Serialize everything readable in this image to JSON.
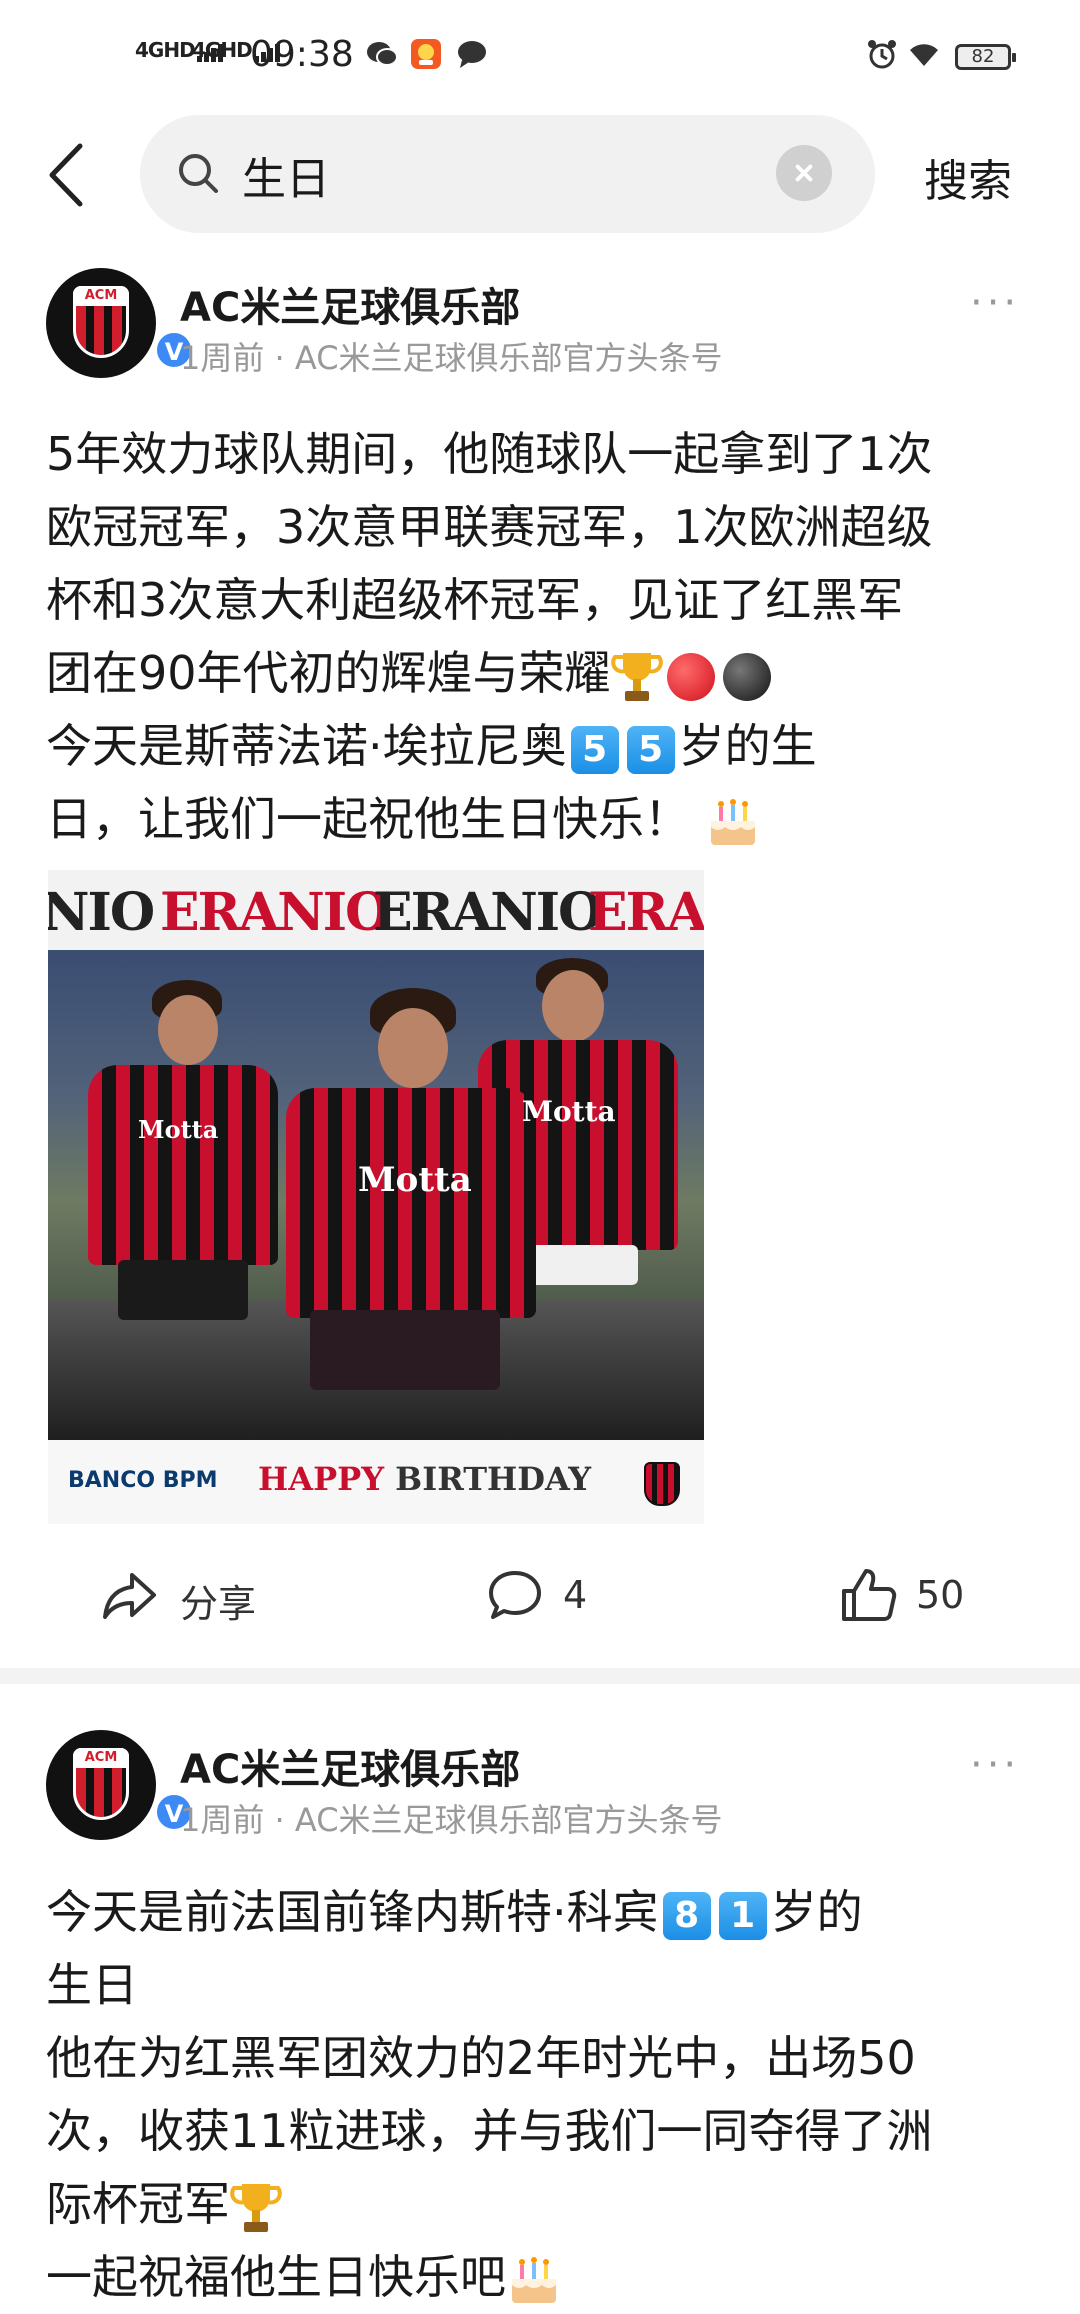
{
  "status_bar": {
    "signal1": "4GHD",
    "signal2": "4GHD",
    "time": "09:38",
    "battery": "82"
  },
  "search": {
    "query": "生日",
    "submit_label": "搜索"
  },
  "posts": [
    {
      "author": "AC米兰足球俱乐部",
      "meta": "1周前 · AC米兰足球俱乐部官方头条号",
      "text_lines": [
        "5年效力球队期间，他随球队一起拿到了1次",
        "欧冠冠军，3次意甲联赛冠军，1次欧洲超级",
        "杯和3次意大利超级杯冠军，见证了红黑军",
        "团在90年代初的辉煌与荣耀",
        "今天是斯蒂法诺·埃拉尼奥",
        "岁的生",
        "日，让我们一起祝他生日快乐！"
      ],
      "age_digits": [
        "5",
        "5"
      ],
      "image": {
        "banner_text": "NIO ERANIO ERANIO ERA",
        "banner_words": [
          "NIO",
          "ERANIO",
          "ERANIO",
          "ERA"
        ],
        "sponsor": "BANCO BPM",
        "caption_1": "HAPPY",
        "caption_2": "BIRTHDAY",
        "shirt_text": "Motta"
      },
      "actions": {
        "share_label": "分享",
        "comments": "4",
        "likes": "50"
      }
    },
    {
      "author": "AC米兰足球俱乐部",
      "meta": "1周前 · AC米兰足球俱乐部官方头条号",
      "text_lines": [
        "今天是前法国前锋内斯特·科宾",
        "岁的",
        "生日",
        "他在为红黑军团效力的2年时光中，出场50",
        "次，收获11粒进球，并与我们一同夺得了洲",
        "际杯冠军",
        "一起祝福他生日快乐吧"
      ],
      "age_digits": [
        "8",
        "1"
      ]
    }
  ],
  "colors": {
    "milan_red": "#c8102e",
    "milan_black": "#141414",
    "verified_blue": "#3d8af7",
    "meta_gray": "#999999"
  }
}
